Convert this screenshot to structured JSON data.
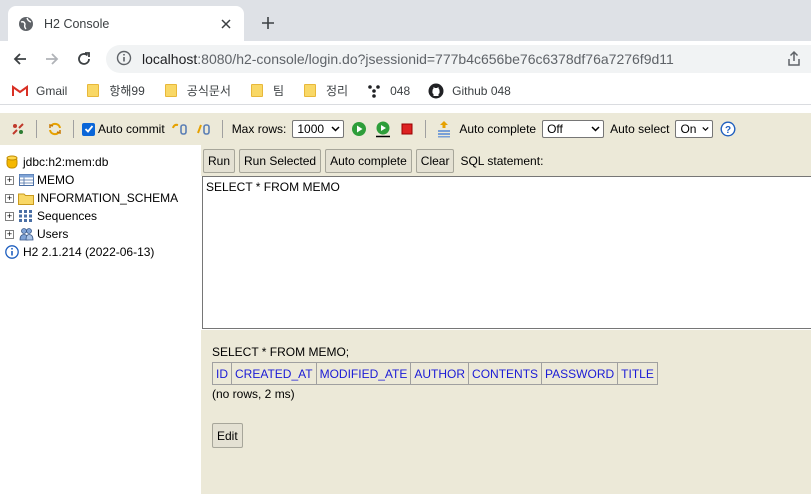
{
  "browser": {
    "tab_title": "H2 Console",
    "url_host": "localhost",
    "url_path": ":8080/h2-console/login.do?jsessionid=777b4c656be76c6378df76a7276f9d11",
    "bookmarks": [
      {
        "label": "Gmail",
        "icon": "gmail-icon"
      },
      {
        "label": "항해99",
        "icon": "folder-icon"
      },
      {
        "label": "공식문서",
        "icon": "folder-icon"
      },
      {
        "label": "팀",
        "icon": "folder-icon"
      },
      {
        "label": "정리",
        "icon": "folder-icon"
      },
      {
        "label": "048",
        "icon": "git-branch-icon"
      },
      {
        "label": "Github 048",
        "icon": "github-icon"
      }
    ]
  },
  "toolbar": {
    "auto_commit_label": "Auto commit",
    "auto_commit_checked": true,
    "max_rows_label": "Max rows:",
    "max_rows_value": "1000",
    "auto_complete_label": "Auto complete",
    "auto_complete_value": "Off",
    "auto_select_label": "Auto select",
    "auto_select_value": "On"
  },
  "tree": {
    "connection": "jdbc:h2:mem:db",
    "items": [
      {
        "label": "MEMO",
        "icon": "table-icon"
      },
      {
        "label": "INFORMATION_SCHEMA",
        "icon": "folder-icon"
      },
      {
        "label": "Sequences",
        "icon": "sequences-icon"
      },
      {
        "label": "Users",
        "icon": "users-icon"
      }
    ],
    "version": "H2 2.1.214 (2022-06-13)"
  },
  "query": {
    "buttons": {
      "run": "Run",
      "run_selected": "Run Selected",
      "auto_complete": "Auto complete",
      "clear": "Clear"
    },
    "sql_label": "SQL statement:",
    "sql_text": "SELECT * FROM MEMO"
  },
  "result": {
    "statement": "SELECT * FROM MEMO;",
    "columns": [
      "ID",
      "CREATED_AT",
      "MODIFIED_ATE",
      "AUTHOR",
      "CONTENTS",
      "PASSWORD",
      "TITLE"
    ],
    "info": "(no rows, 2 ms)",
    "edit_label": "Edit"
  },
  "colors": {
    "panel_bg": "#ece9d8",
    "column_header_text": "#1a1ad6",
    "checkbox_blue": "#0a66d8"
  }
}
